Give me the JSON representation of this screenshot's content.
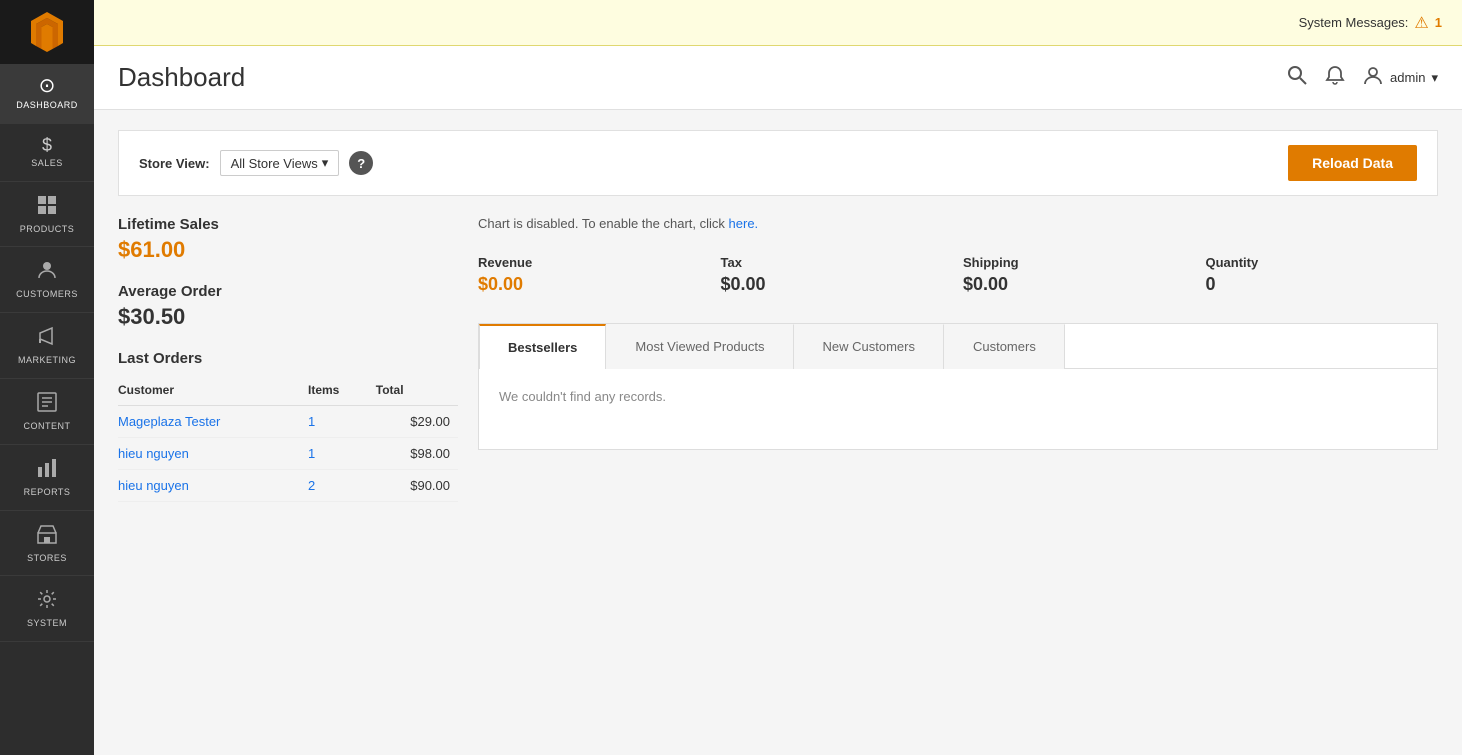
{
  "sidebar": {
    "items": [
      {
        "id": "dashboard",
        "label": "DASHBOARD",
        "icon": "⊙",
        "active": true
      },
      {
        "id": "sales",
        "label": "SALES",
        "icon": "$"
      },
      {
        "id": "products",
        "label": "PRODUCTS",
        "icon": "⬡"
      },
      {
        "id": "customers",
        "label": "CUSTOMERS",
        "icon": "👤"
      },
      {
        "id": "marketing",
        "label": "MARKETING",
        "icon": "📢"
      },
      {
        "id": "content",
        "label": "CONTENT",
        "icon": "▦"
      },
      {
        "id": "reports",
        "label": "REPORTS",
        "icon": "📊"
      },
      {
        "id": "stores",
        "label": "STORES",
        "icon": "🏪"
      },
      {
        "id": "system",
        "label": "SYSTEM",
        "icon": "⚙"
      }
    ]
  },
  "system_message": {
    "label": "System Messages:",
    "count": "1"
  },
  "header": {
    "title": "Dashboard",
    "admin_label": "admin"
  },
  "store_view": {
    "label": "Store View:",
    "selected": "All Store Views",
    "reload_button": "Reload Data"
  },
  "lifetime_sales": {
    "label": "Lifetime Sales",
    "value": "$61.00"
  },
  "average_order": {
    "label": "Average Order",
    "value": "$30.50"
  },
  "last_orders": {
    "title": "Last Orders",
    "columns": [
      "Customer",
      "Items",
      "Total"
    ],
    "rows": [
      {
        "customer": "Mageplaza Tester",
        "items": "1",
        "total": "$29.00"
      },
      {
        "customer": "hieu nguyen",
        "items": "1",
        "total": "$98.00"
      },
      {
        "customer": "hieu nguyen",
        "items": "2",
        "total": "$90.00"
      }
    ]
  },
  "chart_message": {
    "text": "Chart is disabled. To enable the chart, click",
    "link": "here."
  },
  "stats": {
    "revenue": {
      "label": "Revenue",
      "value": "$0.00"
    },
    "tax": {
      "label": "Tax",
      "value": "$0.00"
    },
    "shipping": {
      "label": "Shipping",
      "value": "$0.00"
    },
    "quantity": {
      "label": "Quantity",
      "value": "0"
    }
  },
  "tabs": [
    {
      "id": "bestsellers",
      "label": "Bestsellers",
      "active": true
    },
    {
      "id": "most-viewed",
      "label": "Most Viewed Products"
    },
    {
      "id": "new-customers",
      "label": "New Customers"
    },
    {
      "id": "customers",
      "label": "Customers"
    }
  ],
  "tab_empty_message": "We couldn't find any records."
}
